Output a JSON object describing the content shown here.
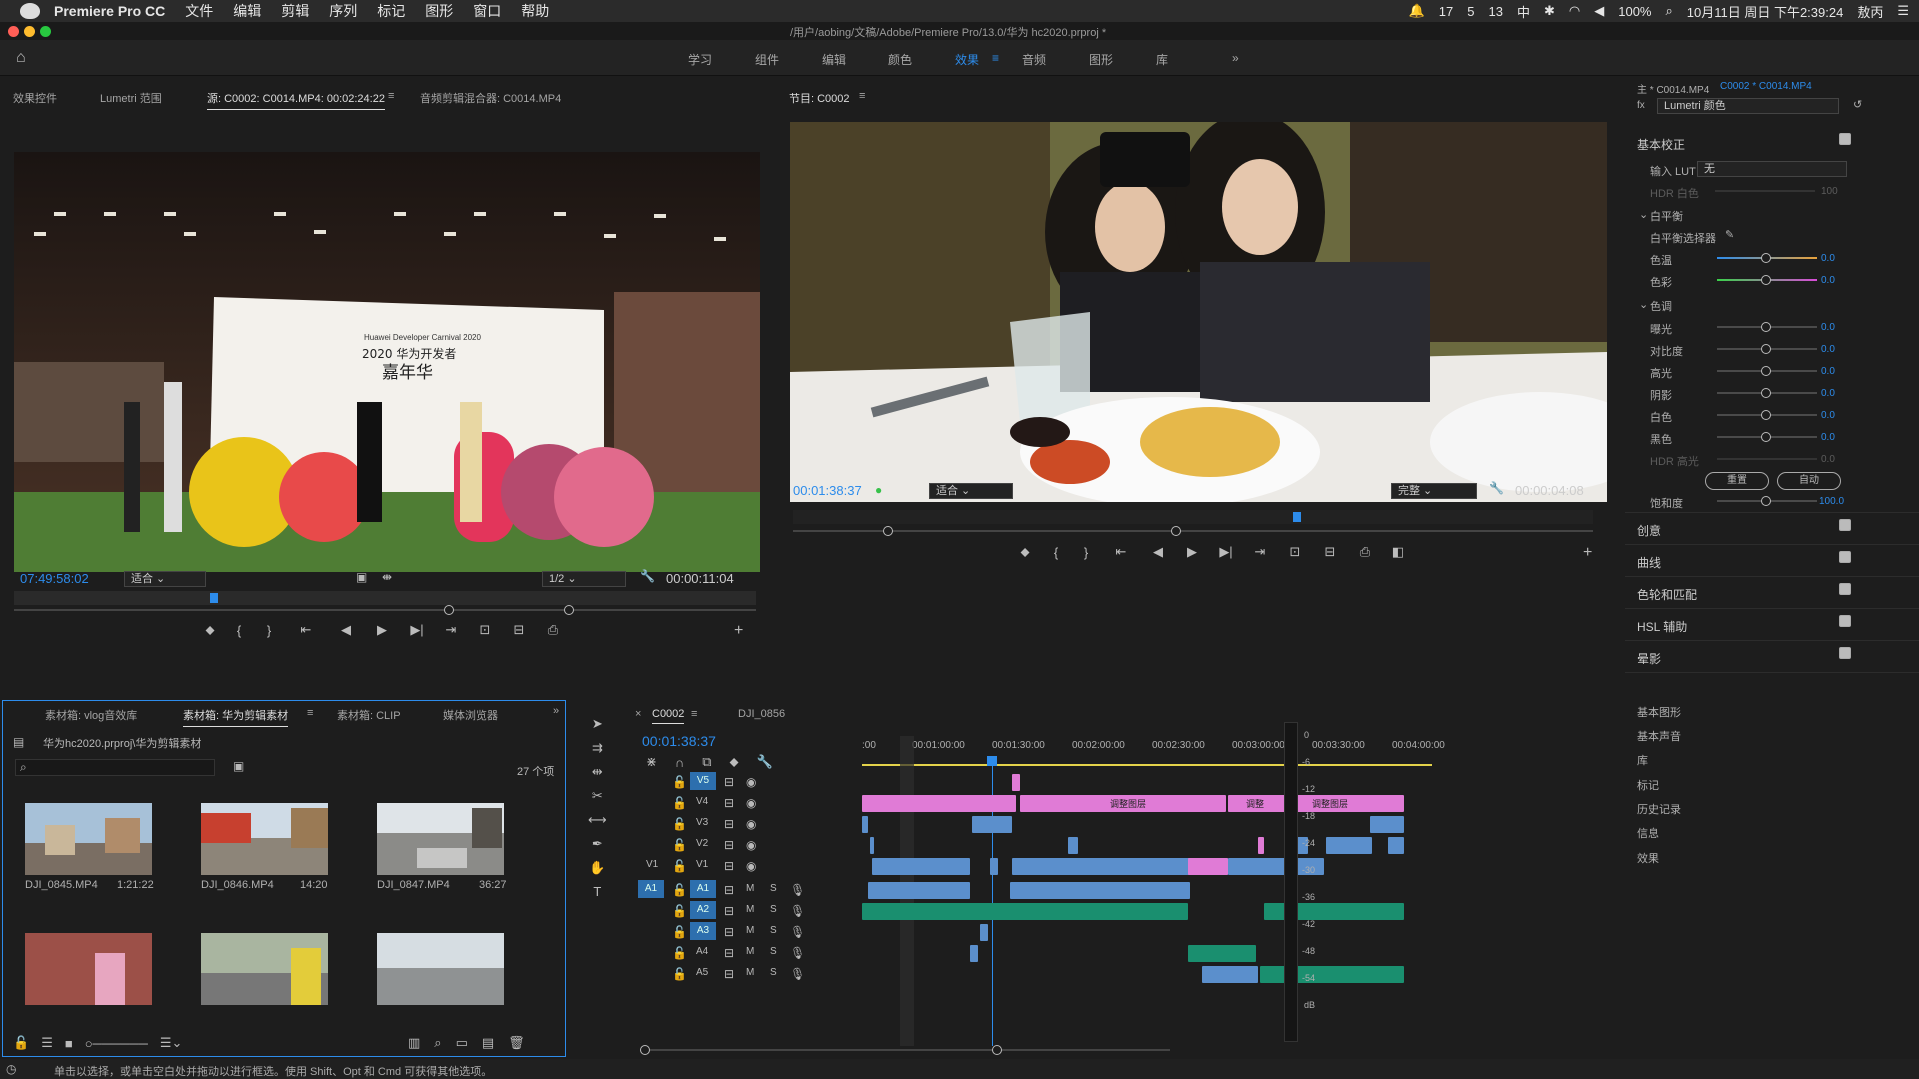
{
  "menubar": {
    "app": "Premiere Pro CC",
    "items": [
      "文件",
      "编辑",
      "剪辑",
      "序列",
      "标记",
      "图形",
      "窗口",
      "帮助"
    ],
    "status": {
      "badge1": "17",
      "badge2": "5",
      "badge3": "13",
      "battery": "100%",
      "datetime": "10月11日 周日 下午2:39:24",
      "user": "敖丙"
    }
  },
  "window": {
    "path": "/用户/aobing/文稿/Adobe/Premiere Pro/13.0/华为 hc2020.prproj *"
  },
  "workspaces": [
    "学习",
    "组件",
    "编辑",
    "颜色",
    "效果",
    "音频",
    "图形",
    "库"
  ],
  "active_workspace": "效果",
  "source": {
    "tabs": [
      "效果控件",
      "Lumetri 范围",
      "源: C0002: C0014.MP4: 00:02:24:22",
      "音频剪辑混合器: C0014.MP4"
    ],
    "timecode": "07:49:58:02",
    "fit": "适合",
    "resolution": "1/2",
    "duration": "00:00:11:04"
  },
  "program": {
    "tab": "节目: C0002",
    "timecode": "00:01:38:37",
    "fit": "适合",
    "quality": "完整",
    "duration": "00:00:04:08"
  },
  "bins": {
    "tabs": [
      "素材箱: vlog音效库",
      "素材箱: 华为剪辑素材",
      "素材箱: CLIP",
      "媒体浏览器"
    ],
    "path": "华为hc2020.prproj\\华为剪辑素材",
    "count": "27 个项",
    "items": [
      {
        "name": "DJI_0845.MP4",
        "dur": "1:21:22"
      },
      {
        "name": "DJI_0846.MP4",
        "dur": "14:20"
      },
      {
        "name": "DJI_0847.MP4",
        "dur": "36:27"
      },
      {
        "name": "",
        "dur": ""
      },
      {
        "name": "",
        "dur": ""
      },
      {
        "name": "",
        "dur": ""
      }
    ]
  },
  "timeline": {
    "tabs": [
      "C0002",
      "DJI_0856"
    ],
    "timecode": "00:01:38:37",
    "ruler": [
      ":00",
      "00:01:00:00",
      "00:01:30:00",
      "00:02:00:00",
      "00:02:30:00",
      "00:03:00:00",
      "00:03:30:00",
      "00:04:00:00"
    ],
    "video_tracks": [
      "V5",
      "V4",
      "V3",
      "V2",
      "V1"
    ],
    "audio_tracks": [
      "A1",
      "A2",
      "A3",
      "A4",
      "A5"
    ],
    "adjustment_label": "调整图层",
    "meter_scale": [
      "0",
      "-6",
      "-12",
      "-18",
      "-24",
      "-30",
      "-36",
      "-42",
      "-48",
      "-54",
      "dB"
    ]
  },
  "lumetri": {
    "clip_master": "主 * C0014.MP4",
    "clip_seq": "C0002 * C0014.MP4",
    "effect": "Lumetri 颜色",
    "basic": "基本校正",
    "input_lut": "输入 LUT",
    "lut_value": "无",
    "hdr_white": "HDR 白色",
    "hdr_white_val": "100",
    "wb": "白平衡",
    "wb_selector": "白平衡选择器",
    "temp": "色温",
    "temp_val": "0.0",
    "tint": "色彩",
    "tint_val": "0.0",
    "tone": "色调",
    "tone_rows": [
      {
        "label": "曝光",
        "val": "0.0"
      },
      {
        "label": "对比度",
        "val": "0.0"
      },
      {
        "label": "高光",
        "val": "0.0"
      },
      {
        "label": "阴影",
        "val": "0.0"
      },
      {
        "label": "白色",
        "val": "0.0"
      },
      {
        "label": "黑色",
        "val": "0.0"
      },
      {
        "label": "HDR 高光",
        "val": "0.0"
      }
    ],
    "reset": "重置",
    "auto": "自动",
    "saturation": "饱和度",
    "saturation_val": "100.0",
    "sections": [
      "创意",
      "曲线",
      "色轮和匹配",
      "HSL 辅助",
      "晕影"
    ],
    "bottom_panels": [
      "基本图形",
      "基本声音",
      "库",
      "标记",
      "历史记录",
      "信息",
      "效果"
    ]
  },
  "status_bar": "单击以选择，或单击空白处并拖动以进行框选。使用 Shift、Opt 和 Cmd 可获得其他选项。",
  "source_stage": {
    "event_small": "Huawei Developer Carnival 2020",
    "event_title": "2020 华为开发者",
    "event_title2": "嘉年华"
  },
  "colors": {
    "accent": "#2d8ceb",
    "adjust": "#e07bd6",
    "clip_blue": "#5b8fcc",
    "audio": "#1a8f6f"
  }
}
